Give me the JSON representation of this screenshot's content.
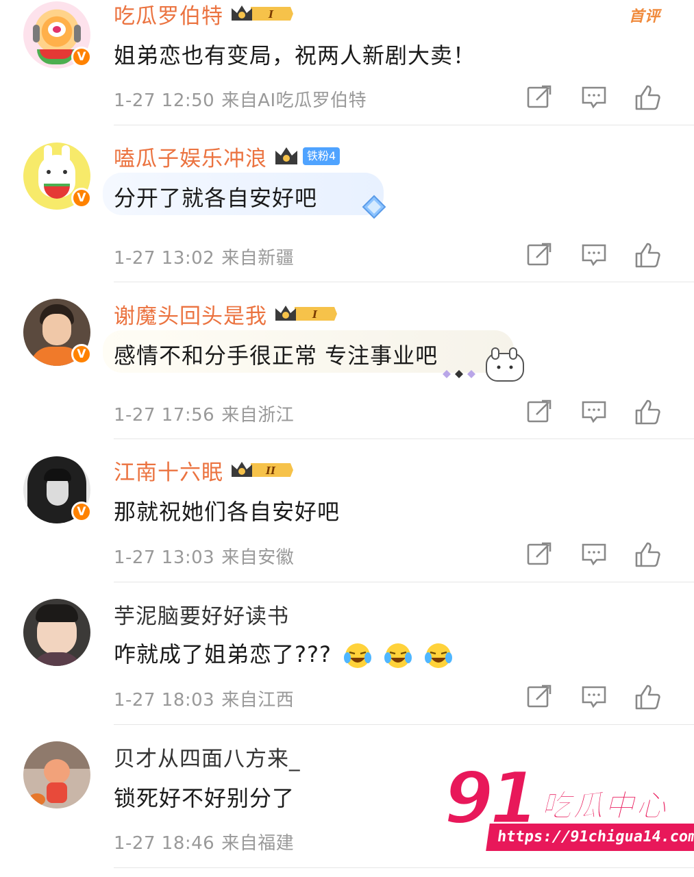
{
  "top_tag": "首评",
  "comments": [
    {
      "user": "吃瓜罗伯特",
      "level_badge": "I",
      "text": "姐弟恋也有变局，祝两人新剧大卖！",
      "time": "1-27 12:50",
      "from": "来自AI吃瓜罗伯特"
    },
    {
      "user": "嗑瓜子娱乐冲浪",
      "fan_badge": "铁粉4",
      "text": "分开了就各自安好吧",
      "time": "1-27 13:02",
      "from": "来自新疆"
    },
    {
      "user": "谢魔头回头是我",
      "level_badge": "I",
      "text": "感情不和分手很正常 专注事业吧",
      "time": "1-27 17:56",
      "from": "来自浙江"
    },
    {
      "user": "江南十六眠",
      "level_badge": "II",
      "text": "那就祝她们各自安好吧",
      "time": "1-27 13:03",
      "from": "来自安徽"
    },
    {
      "user": "芋泥脑要好好读书",
      "text": "咋就成了姐弟恋了???",
      "time": "1-27 18:03",
      "from": "来自江西"
    },
    {
      "user": "贝才从四面八方来_",
      "text": "锁死好不好别分了",
      "time": "1-27 18:46",
      "from": "来自福建"
    }
  ],
  "watermark": {
    "number": "91",
    "name": "吃瓜中心",
    "url": "https://91chigua14.com"
  },
  "icons": {
    "repost": "repost-icon",
    "comment": "comment-icon",
    "like": "like-icon",
    "verified": "verified-v-icon",
    "crown": "crown-icon"
  },
  "colors": {
    "vip_name": "#eb7340",
    "meta": "#999999",
    "verified": "#ff8200",
    "watermark": "#e8185a",
    "fan_badge": "#4fa3ff"
  }
}
